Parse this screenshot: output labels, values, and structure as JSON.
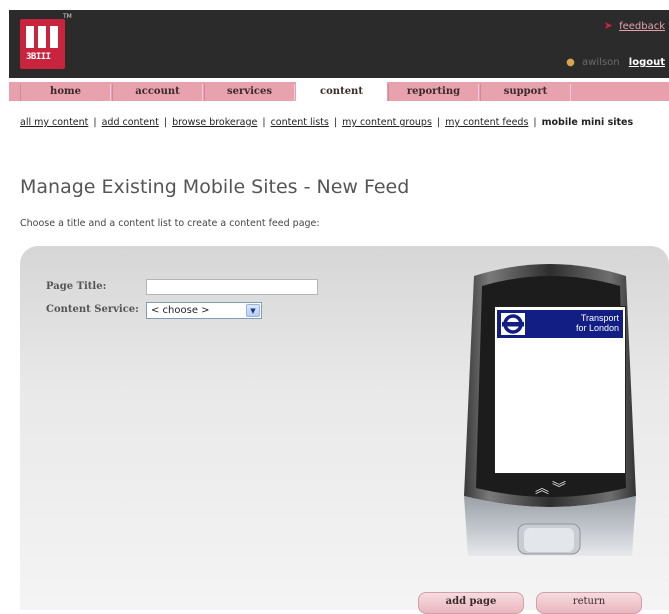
{
  "header": {
    "logo_mark": "3BIII",
    "logo_tm": "TM",
    "feedback_label": "feedback",
    "username": "awilson",
    "logout_label": "logout"
  },
  "tabs": [
    {
      "label": "home",
      "active": false
    },
    {
      "label": "account",
      "active": false
    },
    {
      "label": "services",
      "active": false
    },
    {
      "label": "content",
      "active": true
    },
    {
      "label": "reporting",
      "active": false
    },
    {
      "label": "support",
      "active": false
    }
  ],
  "subnav": {
    "links": [
      "all my content",
      "add content",
      "browse brokerage",
      "content lists",
      "my content groups",
      "my content feeds"
    ],
    "current": "mobile mini sites",
    "separator": "|"
  },
  "page": {
    "title": "Manage Existing Mobile Sites - New Feed",
    "instructions": "Choose a title and a content list to create a content feed page:"
  },
  "form": {
    "page_title_label": "Page Title:",
    "page_title_value": "",
    "content_service_label": "Content Service:",
    "content_service_selected": "< choose >"
  },
  "phone_preview": {
    "brand_line1": "Transport",
    "brand_line2": "for London",
    "brand_color": "#121e84",
    "roundel_color": "#dc241f"
  },
  "actions": {
    "add_page_label": "add page",
    "return_label": "return"
  },
  "colors": {
    "header_bg": "#2b2b2b",
    "brand_red": "#c8243e",
    "tab_pink": "#e7a0ac"
  }
}
